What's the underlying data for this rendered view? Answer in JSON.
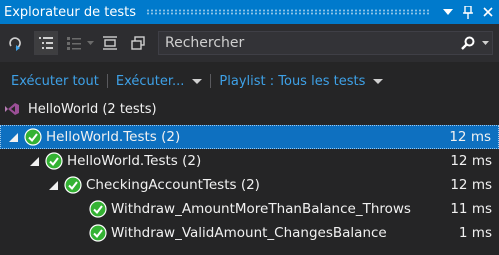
{
  "window": {
    "title": "Explorateur de tests"
  },
  "search": {
    "placeholder": "Rechercher",
    "value": ""
  },
  "actions": {
    "run_all": "Exécuter tout",
    "run": "Exécuter...",
    "playlist": "Playlist : Tous les tests"
  },
  "project": {
    "label": "HelloWorld (2 tests)"
  },
  "tree": [
    {
      "label": "HelloWorld.Tests (2)",
      "duration": "12 ms",
      "status": "passed",
      "selected": true
    },
    {
      "label": "HelloWorld.Tests (2)",
      "duration": "12 ms",
      "status": "passed",
      "selected": false
    },
    {
      "label": "CheckingAccountTests (2)",
      "duration": "12 ms",
      "status": "passed",
      "selected": false
    },
    {
      "label": "Withdraw_AmountMoreThanBalance_Throws",
      "duration": "11 ms",
      "status": "passed",
      "selected": false
    },
    {
      "label": "Withdraw_ValidAmount_ChangesBalance",
      "duration": "1 ms",
      "status": "passed",
      "selected": false
    }
  ],
  "colors": {
    "accent": "#007acc",
    "link": "#3ea1e7",
    "pass": "#34b233",
    "selected_row": "#0e70c0",
    "background": "#252526"
  }
}
